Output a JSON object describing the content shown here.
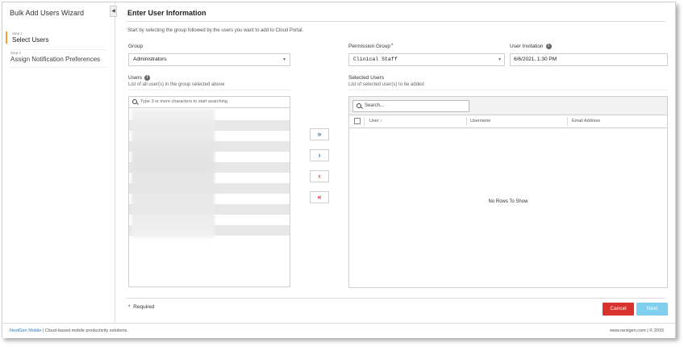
{
  "sidebar": {
    "title": "Bulk Add Users Wizard",
    "collapse_glyph": "◀",
    "steps": [
      {
        "num": "Step 1",
        "label": "Select Users"
      },
      {
        "num": "Step 2",
        "label": "Assign Notification Preferences"
      }
    ]
  },
  "main": {
    "title": "Enter User Information",
    "intro": "Start by selecting the group followed by the users you want to add to Cloud Portal.",
    "group": {
      "label": "Group",
      "value": "Administrators"
    },
    "permission_group": {
      "label": "Permission Group",
      "required_mark": "*",
      "value": "Clinical Staff"
    },
    "user_invitation": {
      "label": "User Invitation",
      "value": "6/6/2021, 1:30 PM"
    },
    "users": {
      "label": "Users",
      "sub": "List of all user(s) in the group selected above",
      "search_placeholder": "Type 3 or more characters to start searching"
    },
    "selected_users": {
      "label": "Selected Users",
      "sub": "List of selected user(s) to be added",
      "search_placeholder": "Search...",
      "columns": [
        "User",
        "Username",
        "Email Address"
      ],
      "sort_glyph": "↑",
      "empty_text": "No Rows To Show"
    },
    "move_buttons": {
      "add_all": "»",
      "add_one": "›",
      "remove_one": "‹",
      "remove_all": "«"
    },
    "info_glyph": "i",
    "required_note": {
      "mark": "*",
      "text": "Required"
    },
    "cancel_label": "Cancel",
    "next_label": "Next"
  },
  "footer": {
    "brand": "NextGen Mobile",
    "tagline": " | Cloud-based mobile productivity solutions.",
    "right": "www.nextgen.com | © 2015"
  },
  "colors": {
    "accent": "#2a7bbf",
    "cancel": "#d9322c",
    "next": "#7fd0ee",
    "active_step": "#f0a030"
  }
}
